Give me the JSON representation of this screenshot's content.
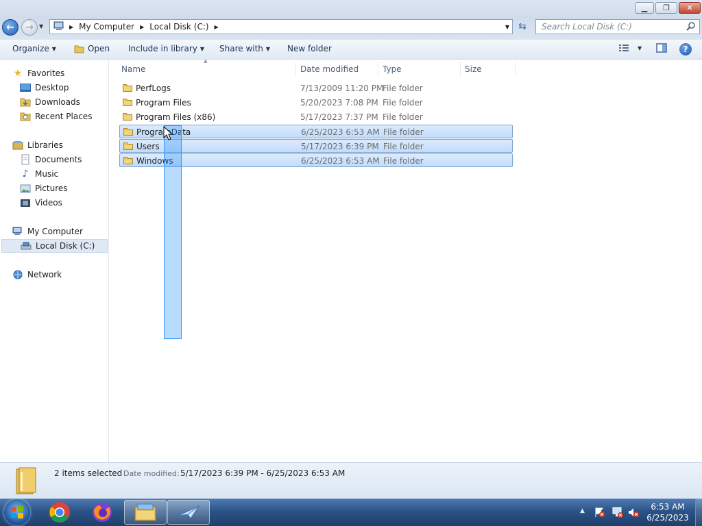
{
  "address": {
    "crumbs": [
      "My Computer",
      "Local Disk (C:)"
    ]
  },
  "search": {
    "placeholder": "Search Local Disk (C:)"
  },
  "toolbar": {
    "organize": "Organize",
    "open": "Open",
    "include_in_library": "Include in library",
    "share_with": "Share with",
    "new_folder": "New folder"
  },
  "nav": {
    "favorites": {
      "label": "Favorites",
      "items": [
        "Desktop",
        "Downloads",
        "Recent Places"
      ]
    },
    "libraries": {
      "label": "Libraries",
      "items": [
        "Documents",
        "Music",
        "Pictures",
        "Videos"
      ]
    },
    "computer": {
      "label": "My Computer",
      "items": [
        "Local Disk (C:)"
      ]
    },
    "network": {
      "label": "Network"
    }
  },
  "columns": {
    "name": "Name",
    "date": "Date modified",
    "type": "Type",
    "size": "Size"
  },
  "files": [
    {
      "name": "PerfLogs",
      "date": "7/13/2009 11:20 PM",
      "type": "File folder",
      "selected": false
    },
    {
      "name": "Program Files",
      "date": "5/20/2023 7:08 PM",
      "type": "File folder",
      "selected": false
    },
    {
      "name": "Program Files (x86)",
      "date": "5/17/2023 7:37 PM",
      "type": "File folder",
      "selected": false
    },
    {
      "name": "ProgramData",
      "date": "6/25/2023 6:53 AM",
      "type": "File folder",
      "selected": true
    },
    {
      "name": "Users",
      "date": "5/17/2023 6:39 PM",
      "type": "File folder",
      "selected": true
    },
    {
      "name": "Windows",
      "date": "6/25/2023 6:53 AM",
      "type": "File folder",
      "selected": true
    }
  ],
  "details": {
    "count": "2 items selected",
    "date_label": "Date modified:",
    "date_value": "5/17/2023 6:39 PM - 6/25/2023 6:53 AM"
  },
  "clock": {
    "time": "6:53 AM",
    "date": "6/25/2023"
  },
  "colors": {
    "selection": "#c1dcfc",
    "taskbar": "#2c5386",
    "accent": "#3399ff"
  }
}
